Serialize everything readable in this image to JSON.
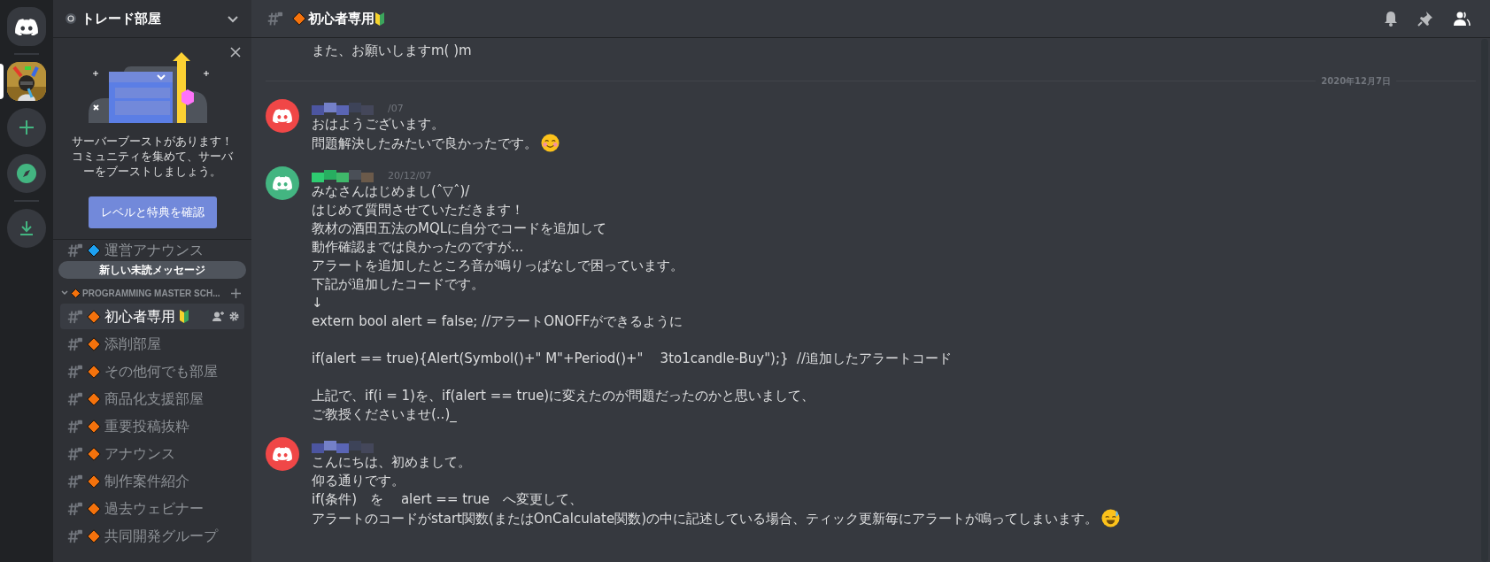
{
  "server_rail": [
    {
      "kind": "home"
    },
    {
      "kind": "server",
      "selected": true
    },
    {
      "kind": "add"
    },
    {
      "kind": "explore"
    },
    {
      "kind": "download"
    }
  ],
  "sidebar": {
    "server_name": "トレード部屋",
    "boost_card": {
      "lines": [
        "サーバーブーストがあります！",
        "コミュニティを集めて、サーバ",
        "ーをブーストしましょう。"
      ],
      "button": "レベルと特典を確認"
    },
    "channels": [
      {
        "name": "運営アナウンス"
      }
    ],
    "unread_pill": "新しい未読メッセージ",
    "category": {
      "name": "PROGRAMMING MASTER SCH...",
      "expanded": true,
      "channels": [
        {
          "name": "初心者専用",
          "beginner_mark": true,
          "selected": true
        },
        {
          "name": "添削部屋",
          "beginner_mark": false,
          "selected": false
        },
        {
          "name": "その他何でも部屋",
          "beginner_mark": false,
          "selected": false
        },
        {
          "name": "商品化支援部屋",
          "beginner_mark": false,
          "selected": false
        },
        {
          "name": "重要投稿抜粋",
          "beginner_mark": false,
          "selected": false
        },
        {
          "name": "アナウンス",
          "beginner_mark": false,
          "selected": false
        },
        {
          "name": "制作案件紹介",
          "beginner_mark": false,
          "selected": false
        },
        {
          "name": "過去ウェビナー",
          "beginner_mark": false,
          "selected": false
        },
        {
          "name": "共同開発グループ",
          "beginner_mark": false,
          "selected": false
        }
      ]
    }
  },
  "header": {
    "channel": "初心者専用",
    "beginner_mark": true
  },
  "messages": [
    {
      "kind": "continuation",
      "lines": [
        {
          "text": "また、お願いしますm( )m"
        }
      ]
    },
    {
      "kind": "divider",
      "date": "2020年12月7日"
    },
    {
      "kind": "message",
      "color": "#f04747",
      "timestamp": "/07",
      "lines": [
        {
          "text": "おはようございます。"
        },
        {
          "text": "問題解決したみたいで良かったです。",
          "kind": "smile"
        }
      ]
    },
    {
      "kind": "message",
      "color": "#43b581",
      "timestamp": "20/12/07",
      "lines": [
        {
          "text": "みなさんはじめまし(ˆ▽ˆ)/"
        },
        {
          "text": "はじめて質問させていただきます！"
        },
        {
          "text": "教材の酒田五法のMQLに自分でコードを追加して"
        },
        {
          "text": "動作確認までは良かったのですが..."
        },
        {
          "text": "アラートを追加したところ音が鳴りっぱなしで困っています。"
        },
        {
          "text": "下記が追加したコードです。"
        },
        {
          "text": "↓"
        },
        {
          "text": "extern bool alert = false; //アラートONOFFができるように"
        }
      ],
      "paragraphs": [
        [
          {
            "text": "if(alert == true){Alert(Symbol()+\" M\"+Period()+\"    3to1candle-Buy\");}  //追加したアラートコード"
          }
        ],
        [
          {
            "text": "上記で、if(i = 1)を、if(alert == true)に変えたのが問題だったのかと思いまして、"
          },
          {
            "text": "ご教授くださいませ(..)_"
          }
        ]
      ]
    },
    {
      "kind": "message",
      "color": "#f04747",
      "lines": [
        {
          "text": "こんにちは、初めまして。"
        },
        {
          "text": "仰る通りです。"
        },
        {
          "text": "if(条件)　を　 alert == true　へ変更して、"
        },
        {
          "text": "アラートのコードがstart関数(またはOnCalculate関数)の中に記述している場合、ティック更新毎にアラートが鳴ってしまいます。",
          "kind": "sweat"
        }
      ]
    }
  ]
}
